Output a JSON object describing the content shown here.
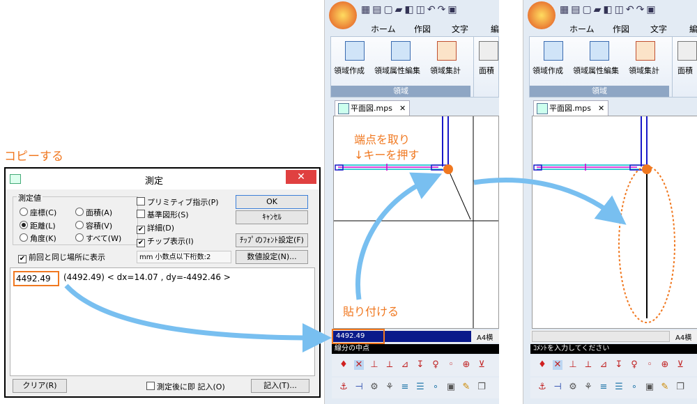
{
  "annotations": {
    "copy": "コピーする",
    "press_key_line1": "端点を取り",
    "press_key_line2": "↓キーを押す",
    "paste": "貼り付ける"
  },
  "dialog": {
    "title": "測定",
    "group_label": "測定値",
    "radios": [
      {
        "label": "座標(C)",
        "checked": false
      },
      {
        "label": "面積(A)",
        "checked": false
      },
      {
        "label": "距離(L)",
        "checked": true
      },
      {
        "label": "容積(V)",
        "checked": false
      },
      {
        "label": "角度(K)",
        "checked": false
      },
      {
        "label": "すべて(W)",
        "checked": false
      }
    ],
    "same_place_label": "前回と同じ場所に表示",
    "primitive_label": "プリミティブ指示(P)",
    "basic_shape_label": "基準図形(S)",
    "detail_label": "詳細(D)",
    "chip_label": "チップ表示(I)",
    "ok_label": "OK",
    "cancel_label": "ｷｬﾝｾﾙ",
    "chip_font_label": "ﾁｯﾌﾟのﾌｫﾝﾄ設定(F)",
    "unit_info": "mm  小数点以下桁数:2",
    "numeric_setting_label": "数値設定(N)...",
    "result_value": "4492.49",
    "result_detail": "(4492.49) < dx=14.07 , dy=-4492.46 >",
    "clear_label": "クリア(R)",
    "record_after_label": "測定後に即 記入(O)",
    "record_label": "記入(T)..."
  },
  "app": {
    "tabs": [
      "ホーム",
      "作図",
      "文字",
      "編"
    ],
    "ribbon_buttons": [
      "領域作成",
      "領域属性編集",
      "領域集計",
      "面積"
    ],
    "group_label": "領域",
    "doc_tab": "平面図.mps",
    "status_paper": "A4横",
    "left_input_value": "4492.49",
    "left_command": "線分の中点",
    "right_command": "ｺﾒﾝﾄを入力してください"
  }
}
